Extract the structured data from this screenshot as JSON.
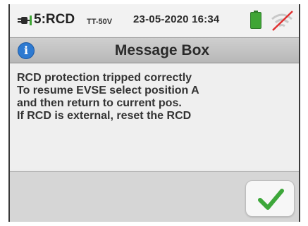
{
  "status": {
    "mode": "5:RCD",
    "system": "TT-50V",
    "datetime": "23-05-2020 16:34",
    "icons": {
      "plug": "plug-icon",
      "battery": "battery-icon",
      "signal": "wifi-off-icon"
    },
    "battery_color": "#3fa535",
    "signal_cross_color": "#e03030"
  },
  "dialog": {
    "title": "Message Box",
    "info_glyph": "i",
    "lines": [
      "RCD protection tripped correctly",
      "To resume EVSE select position A",
      "and then return to current pos.",
      "If RCD is external, reset the RCD"
    ],
    "confirm_icon": "check-icon",
    "confirm_color": "#3da73a"
  }
}
